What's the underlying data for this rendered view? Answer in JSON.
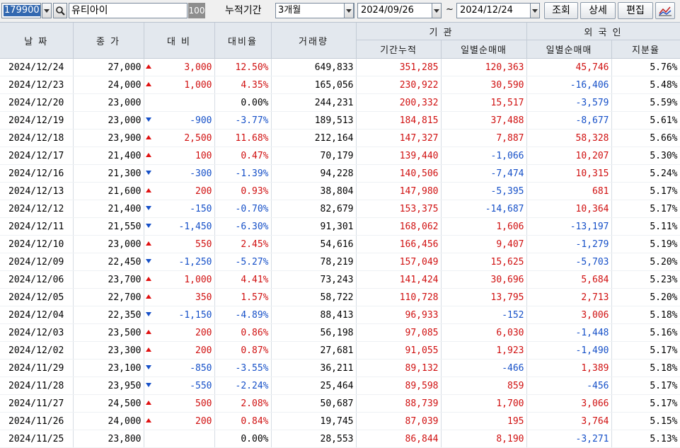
{
  "toolbar": {
    "stock_code": "179900",
    "stock_name": "유티아이",
    "percent_box": "100",
    "period_label": "누적기간",
    "period_value": "3개월",
    "date_from": "2024/09/26",
    "date_separator": "~",
    "date_to": "2024/12/24",
    "query_button": "조회",
    "detail_button": "상세",
    "edit_button": "편집",
    "icons": {
      "dropdown": "chevron-down-icon",
      "search": "magnifier-icon",
      "chart": "line-chart-icon"
    }
  },
  "table": {
    "headers": {
      "date": "날 짜",
      "close": "종 가",
      "change": "대 비",
      "change_rate": "대비율",
      "volume": "거래량",
      "institution": "기  관",
      "inst_cumulative": "기간누적",
      "inst_daily_net": "일별순매매",
      "foreign": "외 국 인",
      "foreign_daily_net": "일별순매매",
      "foreign_holding": "지분율"
    },
    "colors": {
      "up": "#d01010",
      "down": "#1650c8",
      "header_bg": "#e3e8ee"
    },
    "rows": [
      {
        "date": "2024/12/24",
        "close": "27,000",
        "dir": "up",
        "change": "3,000",
        "rate": "12.50%",
        "volume": "649,833",
        "inst_cum": "351,285",
        "inst_net": "120,363",
        "frgn_net": "45,746",
        "frgn_pct": "5.76%"
      },
      {
        "date": "2024/12/23",
        "close": "24,000",
        "dir": "up",
        "change": "1,000",
        "rate": "4.35%",
        "volume": "165,056",
        "inst_cum": "230,922",
        "inst_net": "30,590",
        "frgn_net": "-16,406",
        "frgn_pct": "5.48%"
      },
      {
        "date": "2024/12/20",
        "close": "23,000",
        "dir": "flat",
        "change": "",
        "rate": "0.00%",
        "volume": "244,231",
        "inst_cum": "200,332",
        "inst_net": "15,517",
        "frgn_net": "-3,579",
        "frgn_pct": "5.59%"
      },
      {
        "date": "2024/12/19",
        "close": "23,000",
        "dir": "down",
        "change": "-900",
        "rate": "-3.77%",
        "volume": "189,513",
        "inst_cum": "184,815",
        "inst_net": "37,488",
        "frgn_net": "-8,677",
        "frgn_pct": "5.61%"
      },
      {
        "date": "2024/12/18",
        "close": "23,900",
        "dir": "up",
        "change": "2,500",
        "rate": "11.68%",
        "volume": "212,164",
        "inst_cum": "147,327",
        "inst_net": "7,887",
        "frgn_net": "58,328",
        "frgn_pct": "5.66%"
      },
      {
        "date": "2024/12/17",
        "close": "21,400",
        "dir": "up",
        "change": "100",
        "rate": "0.47%",
        "volume": "70,179",
        "inst_cum": "139,440",
        "inst_net": "-1,066",
        "frgn_net": "10,207",
        "frgn_pct": "5.30%"
      },
      {
        "date": "2024/12/16",
        "close": "21,300",
        "dir": "down",
        "change": "-300",
        "rate": "-1.39%",
        "volume": "94,228",
        "inst_cum": "140,506",
        "inst_net": "-7,474",
        "frgn_net": "10,315",
        "frgn_pct": "5.24%"
      },
      {
        "date": "2024/12/13",
        "close": "21,600",
        "dir": "up",
        "change": "200",
        "rate": "0.93%",
        "volume": "38,804",
        "inst_cum": "147,980",
        "inst_net": "-5,395",
        "frgn_net": "681",
        "frgn_pct": "5.17%"
      },
      {
        "date": "2024/12/12",
        "close": "21,400",
        "dir": "down",
        "change": "-150",
        "rate": "-0.70%",
        "volume": "82,679",
        "inst_cum": "153,375",
        "inst_net": "-14,687",
        "frgn_net": "10,364",
        "frgn_pct": "5.17%"
      },
      {
        "date": "2024/12/11",
        "close": "21,550",
        "dir": "down",
        "change": "-1,450",
        "rate": "-6.30%",
        "volume": "91,301",
        "inst_cum": "168,062",
        "inst_net": "1,606",
        "frgn_net": "-13,197",
        "frgn_pct": "5.11%"
      },
      {
        "date": "2024/12/10",
        "close": "23,000",
        "dir": "up",
        "change": "550",
        "rate": "2.45%",
        "volume": "54,616",
        "inst_cum": "166,456",
        "inst_net": "9,407",
        "frgn_net": "-1,279",
        "frgn_pct": "5.19%"
      },
      {
        "date": "2024/12/09",
        "close": "22,450",
        "dir": "down",
        "change": "-1,250",
        "rate": "-5.27%",
        "volume": "78,219",
        "inst_cum": "157,049",
        "inst_net": "15,625",
        "frgn_net": "-5,703",
        "frgn_pct": "5.20%"
      },
      {
        "date": "2024/12/06",
        "close": "23,700",
        "dir": "up",
        "change": "1,000",
        "rate": "4.41%",
        "volume": "73,243",
        "inst_cum": "141,424",
        "inst_net": "30,696",
        "frgn_net": "5,684",
        "frgn_pct": "5.23%"
      },
      {
        "date": "2024/12/05",
        "close": "22,700",
        "dir": "up",
        "change": "350",
        "rate": "1.57%",
        "volume": "58,722",
        "inst_cum": "110,728",
        "inst_net": "13,795",
        "frgn_net": "2,713",
        "frgn_pct": "5.20%"
      },
      {
        "date": "2024/12/04",
        "close": "22,350",
        "dir": "down",
        "change": "-1,150",
        "rate": "-4.89%",
        "volume": "88,413",
        "inst_cum": "96,933",
        "inst_net": "-152",
        "frgn_net": "3,006",
        "frgn_pct": "5.18%"
      },
      {
        "date": "2024/12/03",
        "close": "23,500",
        "dir": "up",
        "change": "200",
        "rate": "0.86%",
        "volume": "56,198",
        "inst_cum": "97,085",
        "inst_net": "6,030",
        "frgn_net": "-1,448",
        "frgn_pct": "5.16%"
      },
      {
        "date": "2024/12/02",
        "close": "23,300",
        "dir": "up",
        "change": "200",
        "rate": "0.87%",
        "volume": "27,681",
        "inst_cum": "91,055",
        "inst_net": "1,923",
        "frgn_net": "-1,490",
        "frgn_pct": "5.17%"
      },
      {
        "date": "2024/11/29",
        "close": "23,100",
        "dir": "down",
        "change": "-850",
        "rate": "-3.55%",
        "volume": "36,211",
        "inst_cum": "89,132",
        "inst_net": "-466",
        "frgn_net": "1,389",
        "frgn_pct": "5.18%"
      },
      {
        "date": "2024/11/28",
        "close": "23,950",
        "dir": "down",
        "change": "-550",
        "rate": "-2.24%",
        "volume": "25,464",
        "inst_cum": "89,598",
        "inst_net": "859",
        "frgn_net": "-456",
        "frgn_pct": "5.17%"
      },
      {
        "date": "2024/11/27",
        "close": "24,500",
        "dir": "up",
        "change": "500",
        "rate": "2.08%",
        "volume": "50,687",
        "inst_cum": "88,739",
        "inst_net": "1,700",
        "frgn_net": "3,066",
        "frgn_pct": "5.17%"
      },
      {
        "date": "2024/11/26",
        "close": "24,000",
        "dir": "up",
        "change": "200",
        "rate": "0.84%",
        "volume": "19,745",
        "inst_cum": "87,039",
        "inst_net": "195",
        "frgn_net": "3,764",
        "frgn_pct": "5.15%"
      },
      {
        "date": "2024/11/25",
        "close": "23,800",
        "dir": "flat",
        "change": "",
        "rate": "0.00%",
        "volume": "28,553",
        "inst_cum": "86,844",
        "inst_net": "8,190",
        "frgn_net": "-3,271",
        "frgn_pct": "5.13%"
      }
    ]
  }
}
